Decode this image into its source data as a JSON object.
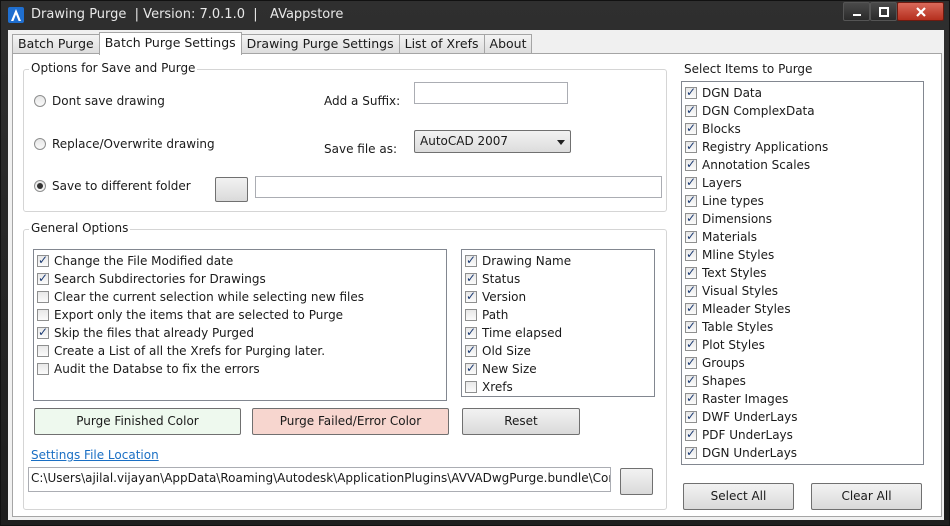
{
  "window": {
    "title": "Drawing Purge  | Version: 7.0.1.0  |   AVappstore"
  },
  "tabs": [
    {
      "label": "Batch Purge"
    },
    {
      "label": "Batch Purge Settings"
    },
    {
      "label": "Drawing Purge Settings"
    },
    {
      "label": "List of Xrefs"
    },
    {
      "label": "About"
    }
  ],
  "save_options": {
    "title": "Options for Save and Purge",
    "radio_dont_save": "Dont save drawing",
    "radio_replace": "Replace/Overwrite drawing",
    "radio_different_folder": "Save to different folder",
    "selected": "radio_different_folder",
    "suffix_label": "Add a Suffix:",
    "suffix_value": "",
    "save_as_label": "Save file as:",
    "save_as_value": "AutoCAD 2007",
    "folder_path_value": ""
  },
  "general_options": {
    "title": "General Options",
    "options": [
      {
        "label": "Change the File Modified date",
        "checked": true
      },
      {
        "label": "Search Subdirectories for Drawings",
        "checked": true
      },
      {
        "label": "Clear the current selection while selecting new files",
        "checked": false
      },
      {
        "label": "Export only the items that are selected to Purge",
        "checked": false
      },
      {
        "label": "Skip the files that already Purged",
        "checked": true
      },
      {
        "label": "Create a List of all the Xrefs for Purging later.",
        "checked": false
      },
      {
        "label": "Audit the Databse to fix the errors",
        "checked": false
      }
    ],
    "columns": [
      {
        "label": "Drawing Name",
        "checked": true
      },
      {
        "label": "Status",
        "checked": true
      },
      {
        "label": "Version",
        "checked": true
      },
      {
        "label": "Path",
        "checked": false
      },
      {
        "label": "Time elapsed",
        "checked": true
      },
      {
        "label": "Old Size",
        "checked": true
      },
      {
        "label": "New Size",
        "checked": true
      },
      {
        "label": "Xrefs",
        "checked": false
      }
    ],
    "purge_finished_label": "Purge Finished Color",
    "purge_failed_label": "Purge Failed/Error Color",
    "reset_label": "Reset",
    "settings_link": "Settings File Location",
    "settings_path": "C:\\Users\\ajilal.vijayan\\AppData\\Roaming\\Autodesk\\ApplicationPlugins\\AVVADwgPurge.bundle\\Contents\\Setti"
  },
  "purge_items": {
    "title": "Select Items to Purge",
    "items": [
      {
        "label": "DGN Data",
        "checked": true
      },
      {
        "label": "DGN ComplexData",
        "checked": true
      },
      {
        "label": "Blocks",
        "checked": true
      },
      {
        "label": "Registry Applications",
        "checked": true
      },
      {
        "label": "Annotation Scales",
        "checked": true
      },
      {
        "label": "Layers",
        "checked": true
      },
      {
        "label": "Line types",
        "checked": true
      },
      {
        "label": "Dimensions",
        "checked": true
      },
      {
        "label": "Materials",
        "checked": true
      },
      {
        "label": "Mline Styles",
        "checked": true
      },
      {
        "label": "Text Styles",
        "checked": true
      },
      {
        "label": "Visual Styles",
        "checked": true
      },
      {
        "label": "Mleader Styles",
        "checked": true
      },
      {
        "label": "Table Styles",
        "checked": true
      },
      {
        "label": "Plot Styles",
        "checked": true
      },
      {
        "label": "Groups",
        "checked": true
      },
      {
        "label": "Shapes",
        "checked": true
      },
      {
        "label": "Raster Images",
        "checked": true
      },
      {
        "label": "DWF UnderLays",
        "checked": true
      },
      {
        "label": "PDF UnderLays",
        "checked": true
      },
      {
        "label": "DGN UnderLays",
        "checked": true
      }
    ],
    "select_all_label": "Select All",
    "clear_all_label": "Clear All"
  },
  "colors": {
    "purge_finished": "#eef9ee",
    "purge_failed": "#f7d6cf",
    "accent": "#1a6fc4"
  }
}
